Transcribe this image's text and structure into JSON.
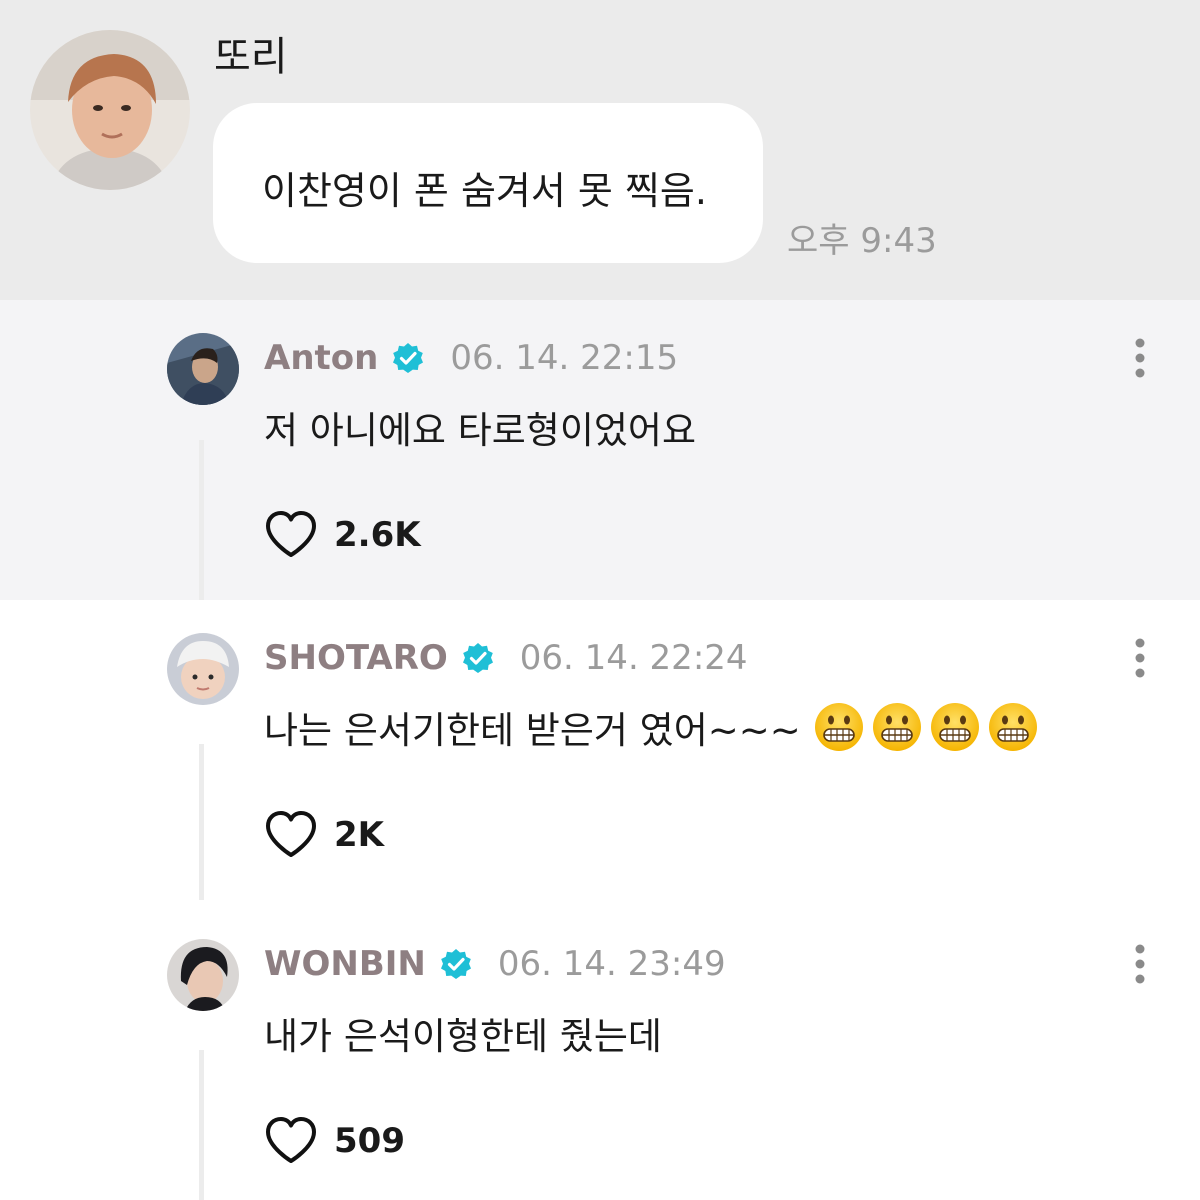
{
  "chat": {
    "sender": "또리",
    "message": "이찬영이 폰 숨겨서 못 찍음.",
    "time": "오후 9:43"
  },
  "comments": [
    {
      "name": "Anton",
      "date": "06. 14. 22:15",
      "text": "저 아니에요 타로형이었어요",
      "likes": "2.6K",
      "verified": true
    },
    {
      "name": "SHOTARO",
      "date": "06. 14. 22:24",
      "text": "나는 은서기한테 받은거 였어~~~",
      "emoji_count": 4,
      "emoji_icon": "grimacing-face-icon",
      "likes": "2K",
      "verified": true
    },
    {
      "name": "WONBIN",
      "date": "06. 14. 23:49",
      "text": "내가 은석이형한테 줬는데",
      "likes": "509",
      "verified": true
    }
  ],
  "colors": {
    "chat_background": "#ebebeb",
    "highlight_background": "#f4f4f6",
    "username": "#8e7f82",
    "verified_badge": "#1fbfd6",
    "muted_text": "#9b9b9b"
  },
  "icons": {
    "verified": "verified-badge-icon",
    "like": "heart-icon",
    "more": "more-vertical-icon"
  }
}
